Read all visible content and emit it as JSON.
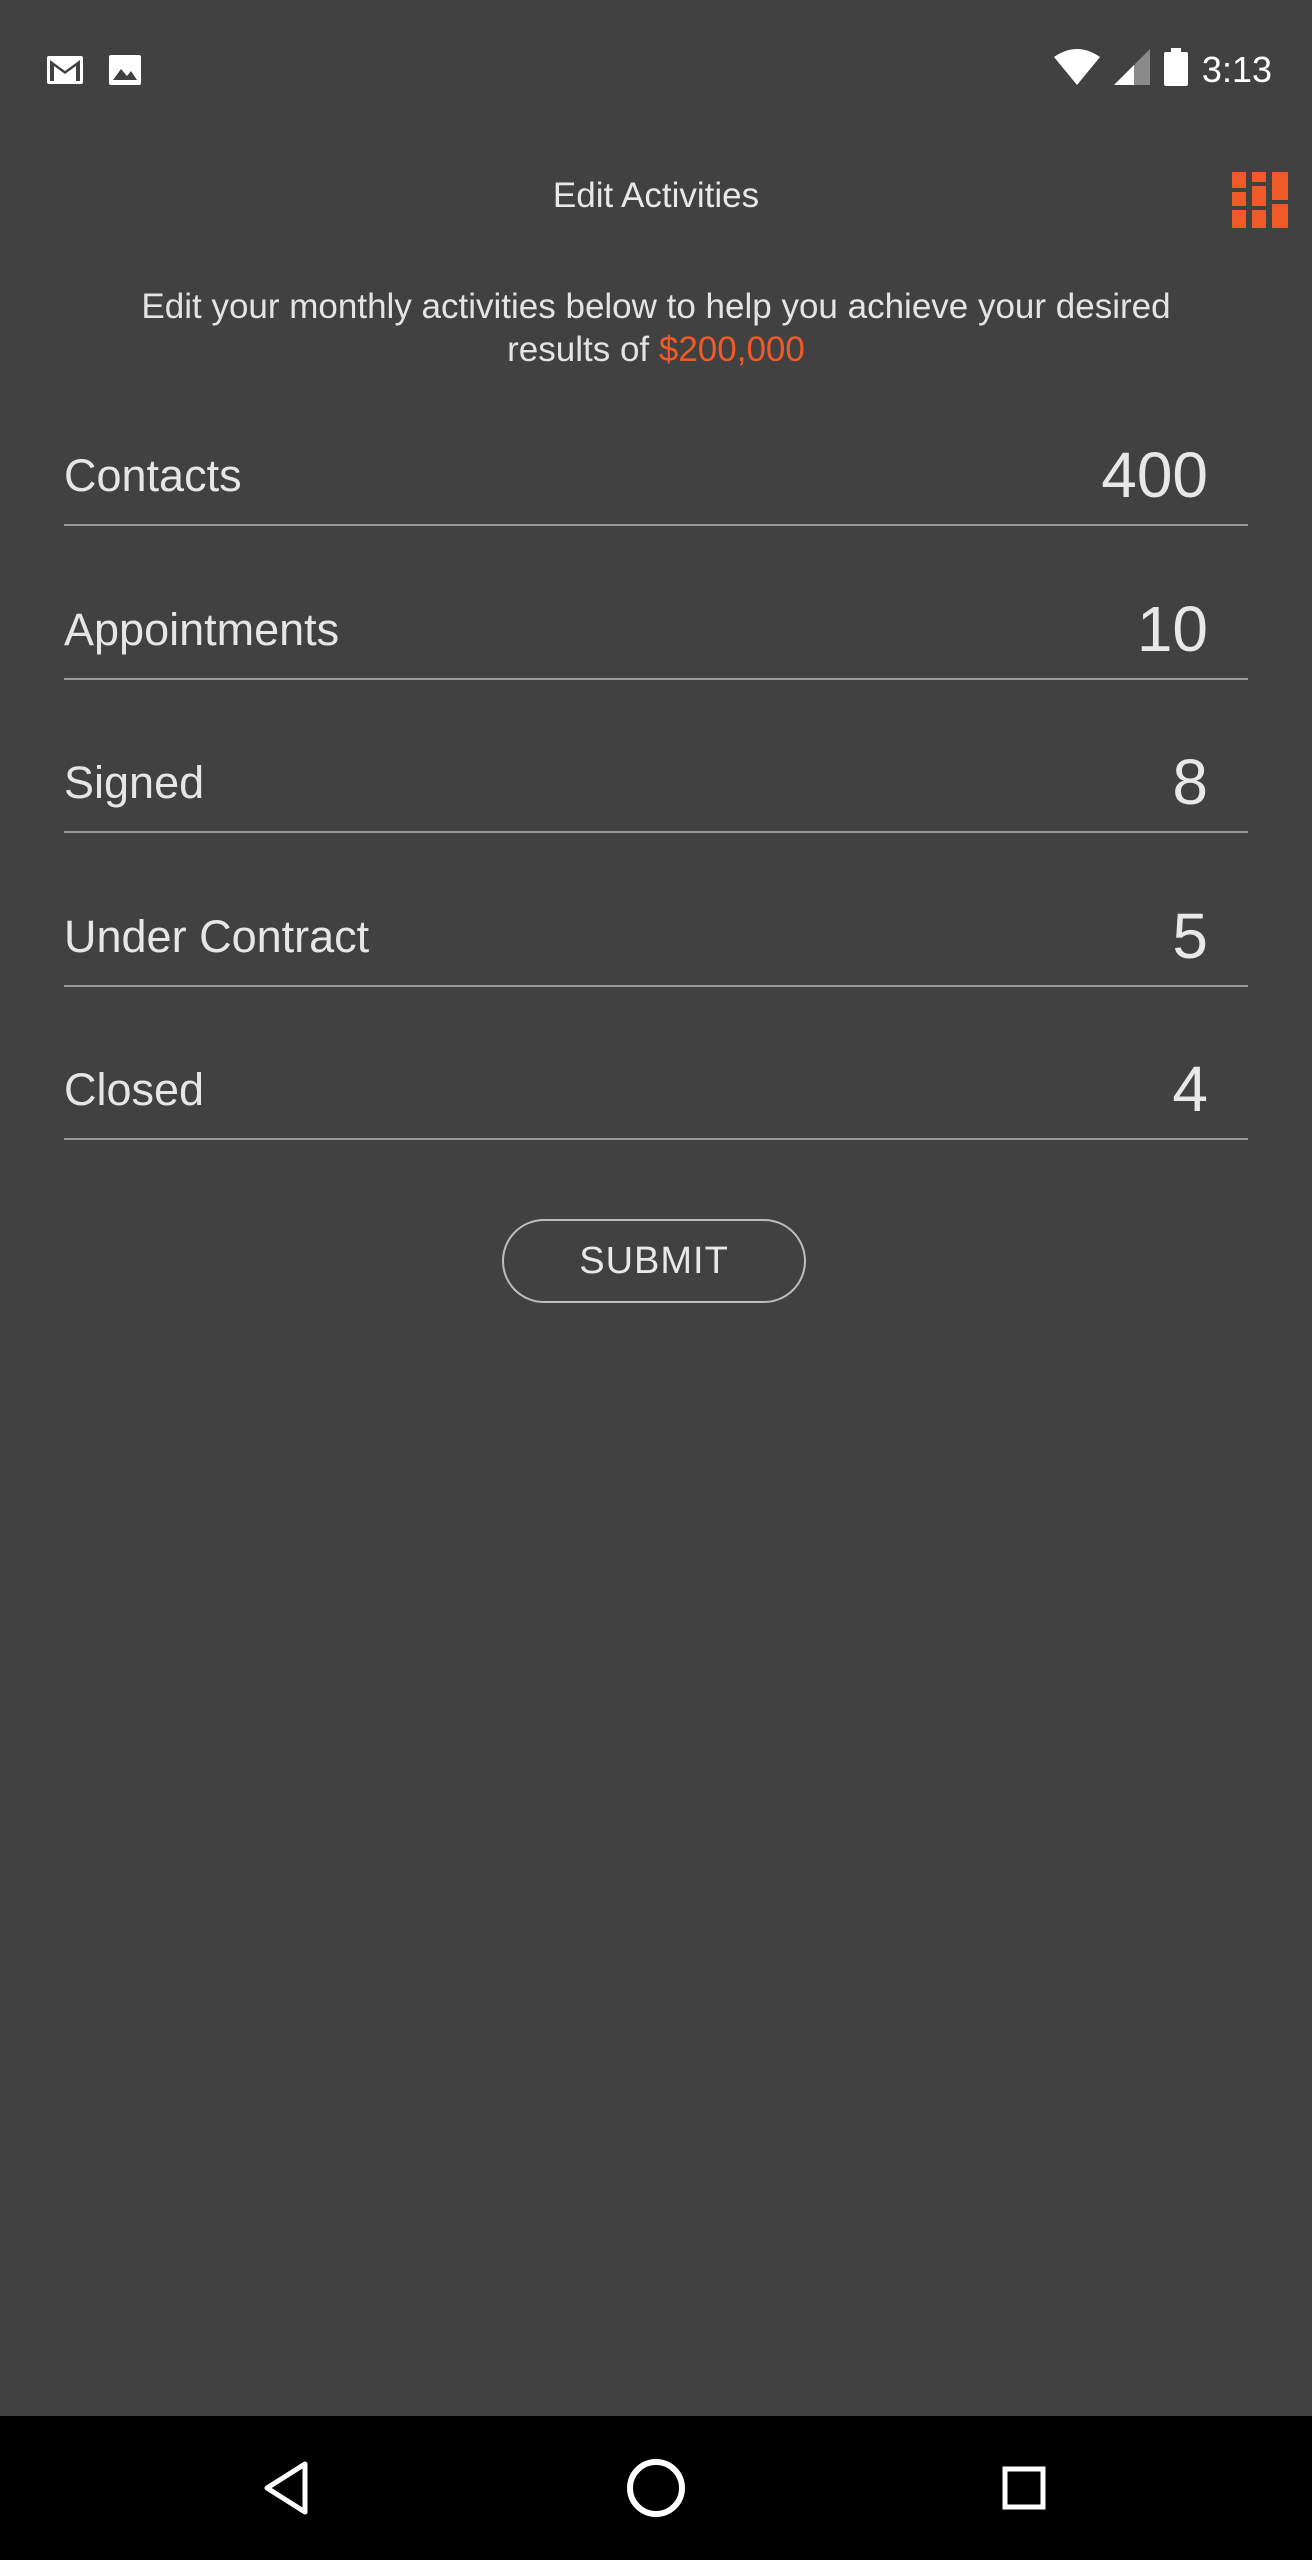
{
  "status_bar": {
    "time": "3:13",
    "left_icons": [
      "gmail-icon",
      "image-icon"
    ],
    "right_icons": [
      "wifi-icon",
      "cell-signal-icon",
      "battery-icon"
    ]
  },
  "header": {
    "title": "Edit Activities",
    "logo_icon": "brand-logo-icon"
  },
  "intro": {
    "text": "Edit your monthly activities below to help you achieve your desired results of ",
    "amount": "$200,000"
  },
  "activities": [
    {
      "label": "Contacts",
      "value": "400"
    },
    {
      "label": "Appointments",
      "value": "10"
    },
    {
      "label": "Signed",
      "value": "8"
    },
    {
      "label": "Under Contract",
      "value": "5"
    },
    {
      "label": "Closed",
      "value": "4"
    }
  ],
  "submit_label": "SUBMIT",
  "colors": {
    "background": "#414141",
    "accent": "#f05a28",
    "nav_bar": "#000000"
  },
  "nav": [
    "back-icon",
    "home-icon",
    "recents-icon"
  ]
}
